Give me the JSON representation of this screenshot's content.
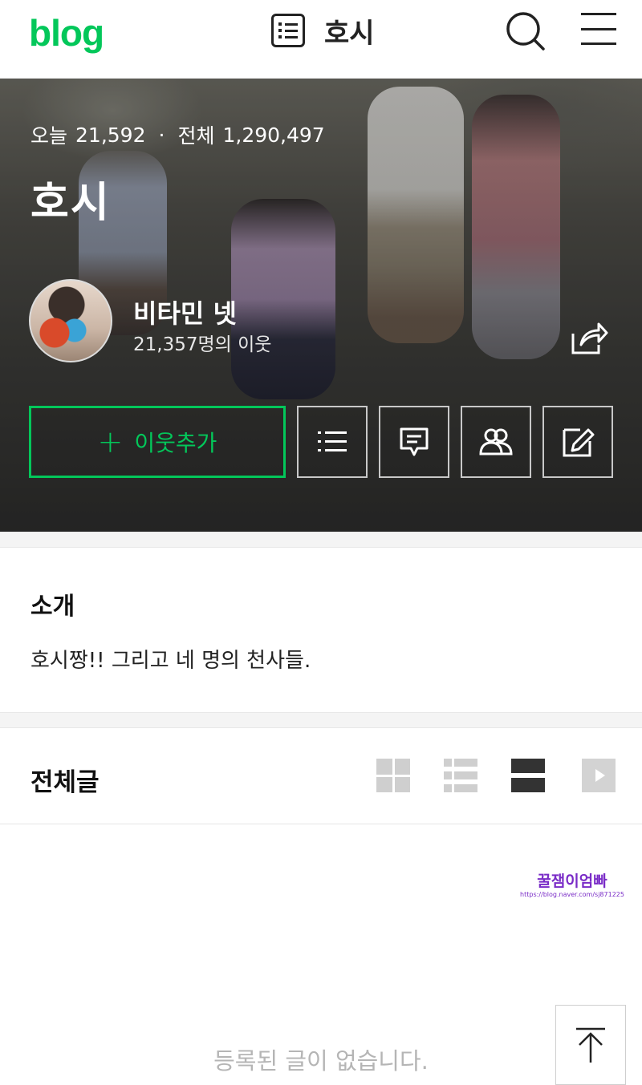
{
  "header": {
    "logo": "blog",
    "title": "호시"
  },
  "hero": {
    "today_label": "오늘",
    "today_count": "21,592",
    "separator": "·",
    "total_label": "전체",
    "total_count": "1,290,497",
    "blog_name": "호시",
    "nickname": "비타민 넷",
    "neighbors": "21,357명의 이웃",
    "add_neighbor_plus": "+",
    "add_neighbor_label": "이웃추가"
  },
  "intro": {
    "title": "소개",
    "text": "호시짱!! 그리고 네 명의 천사들."
  },
  "posts": {
    "title": "전체글",
    "empty_message": "등록된 글이 없습니다."
  },
  "watermark": {
    "title": "꿀잼이엄빠",
    "url": "https://blog.naver.com/sj871225"
  },
  "colors": {
    "brand": "#03c75a",
    "watermark": "#7a2cc7"
  },
  "icons": [
    "list-icon",
    "search-icon",
    "menu-icon",
    "share-icon",
    "post-list-icon",
    "comment-icon",
    "friends-icon",
    "edit-icon",
    "grid-view-icon",
    "list-view-icon",
    "card-view-icon",
    "video-view-icon",
    "scroll-top-icon"
  ]
}
